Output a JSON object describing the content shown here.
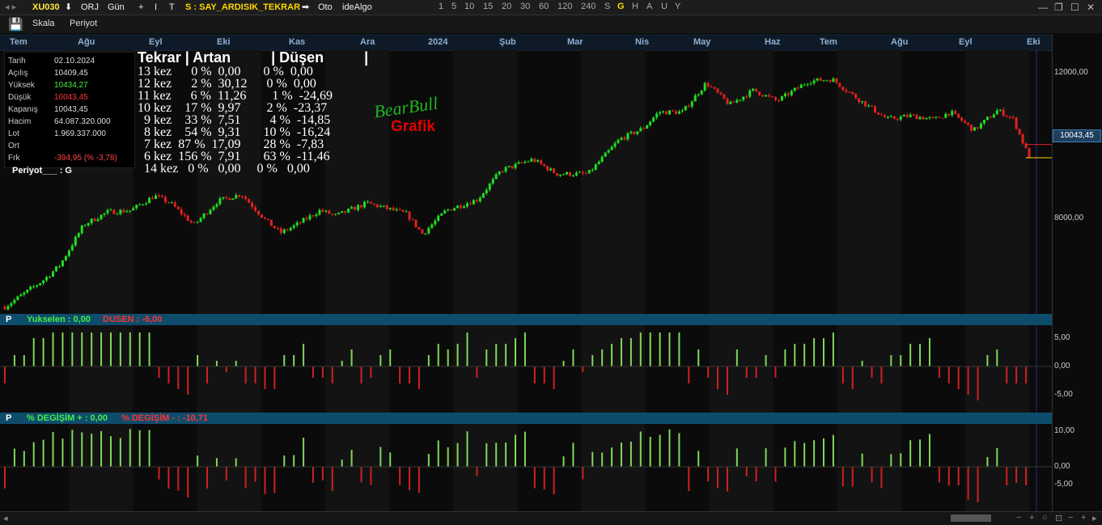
{
  "toolbar": {
    "symbol": "XU030",
    "orj": "ORJ",
    "period": "Gün",
    "plus": "+",
    "draw1": "I",
    "draw2": "T",
    "strategy": "S : SAY_ARDISIK_TEKRAR",
    "oto": "Oto",
    "idealgo": "ideAlgo",
    "timeframes": [
      "1",
      "5",
      "10",
      "15",
      "20",
      "30",
      "60",
      "120",
      "240",
      "S",
      "G",
      "H",
      "A",
      "U",
      "Y"
    ],
    "active_timeframe": "G"
  },
  "menu": {
    "skala": "Skala",
    "periyot": "Periyot"
  },
  "months": [
    "Tem",
    "Ağu",
    "Eyl",
    "Eki",
    "Kas",
    "Ara",
    "2024",
    "Şub",
    "Mar",
    "Nis",
    "May",
    "Haz",
    "Tem",
    "Ağu",
    "Eyl",
    "Eki"
  ],
  "stats": {
    "rows": [
      {
        "label": "Tarih",
        "value": "02.10.2024",
        "color": "#dddddd"
      },
      {
        "label": "Açılış",
        "value": "10409,45",
        "color": "#dddddd"
      },
      {
        "label": "Yüksek",
        "value": "10434,27",
        "color": "#44ee44"
      },
      {
        "label": "Düşük",
        "value": "10043,45",
        "color": "#ff3333"
      },
      {
        "label": "Kapanış",
        "value": "10043,45",
        "color": "#dddddd"
      },
      {
        "label": "Hacim",
        "value": "64.087.320.000",
        "color": "#dddddd"
      },
      {
        "label": "Lot",
        "value": "1.969.337.000",
        "color": "#dddddd"
      },
      {
        "label": "Ort",
        "value": "",
        "color": "#dddddd"
      },
      {
        "label": "Frk",
        "value": "-394,95 (% -3,78)",
        "color": "#ff4444"
      }
    ],
    "periyot": "Periyot___ : G"
  },
  "tekrar": {
    "header": "Tekrar | Artan          | Düşen          |",
    "rows": [
      "13 kez      0 %  0,00       0 %  0,00",
      "12 kez      2 %  30,12      0 %  0,00",
      "11 kez      6 %  11,26        1 %  -24,69",
      "10 kez    17 %  9,97        2 %  -23,37",
      "  9 kez    33 %  7,51         4 %  -14,85",
      "  8 kez    54 %  9,31       10 %  -16,24",
      "  7 kez  87 %  17,09       28 %  -7,83",
      "  6 kez  156 %  7,91       63 %  -11,46",
      "  14 kez   0 %   0,00     0 %   0,00"
    ]
  },
  "logo": {
    "line1": "BearBull",
    "line2": "Grafik"
  },
  "price_axis": {
    "labels": [
      "12000,00",
      "10043,45",
      "8000,00"
    ]
  },
  "panel1": {
    "p": "P",
    "up_label": "Yukselen :  0,00",
    "down_label": "DUSEN :  -6,00",
    "axis": [
      "5,00",
      "0,00",
      "-5,00"
    ]
  },
  "panel2": {
    "p": "P",
    "up_label": "% DEGİŞİM + :  0,00",
    "down_label": "% DEGİŞİM - :  -10,71",
    "axis": [
      "10,00",
      "0,00",
      "-5,00"
    ]
  },
  "colors": {
    "up": "#22dd22",
    "down": "#e02020",
    "accent": "#ffd700",
    "panel_bar": "#0e4c6c"
  },
  "chart_data": {
    "type": "candlestick",
    "x_start": "2023-07",
    "x_end": "2024-10",
    "ylim": [
      5800,
      13000
    ],
    "last_close": 10043.45,
    "trend_points": [
      [
        0,
        5950
      ],
      [
        0.05,
        6700
      ],
      [
        0.07,
        7100
      ],
      [
        0.1,
        8200
      ],
      [
        0.13,
        8550
      ],
      [
        0.16,
        8600
      ],
      [
        0.19,
        9000
      ],
      [
        0.21,
        8800
      ],
      [
        0.24,
        8200
      ],
      [
        0.27,
        8850
      ],
      [
        0.3,
        9050
      ],
      [
        0.33,
        8350
      ],
      [
        0.35,
        7980
      ],
      [
        0.37,
        8200
      ],
      [
        0.4,
        8600
      ],
      [
        0.42,
        8450
      ],
      [
        0.46,
        8800
      ],
      [
        0.51,
        8500
      ],
      [
        0.53,
        7950
      ],
      [
        0.56,
        8600
      ],
      [
        0.6,
        8900
      ],
      [
        0.63,
        9700
      ],
      [
        0.67,
        10000
      ],
      [
        0.7,
        9600
      ],
      [
        0.74,
        9600
      ],
      [
        0.78,
        10550
      ],
      [
        0.81,
        10850
      ],
      [
        0.83,
        11300
      ],
      [
        0.86,
        11300
      ],
      [
        0.89,
        12100
      ],
      [
        0.92,
        11500
      ],
      [
        0.95,
        11900
      ],
      [
        0.98,
        11600
      ],
      [
        1.02,
        12150
      ],
      [
        1.05,
        12200
      ],
      [
        1.08,
        11700
      ],
      [
        1.1,
        11400
      ],
      [
        1.12,
        11100
      ],
      [
        1.15,
        11200
      ],
      [
        1.18,
        11100
      ],
      [
        1.2,
        11300
      ],
      [
        1.23,
        10800
      ],
      [
        1.26,
        11350
      ],
      [
        1.28,
        11100
      ],
      [
        1.3,
        10043
      ]
    ]
  }
}
